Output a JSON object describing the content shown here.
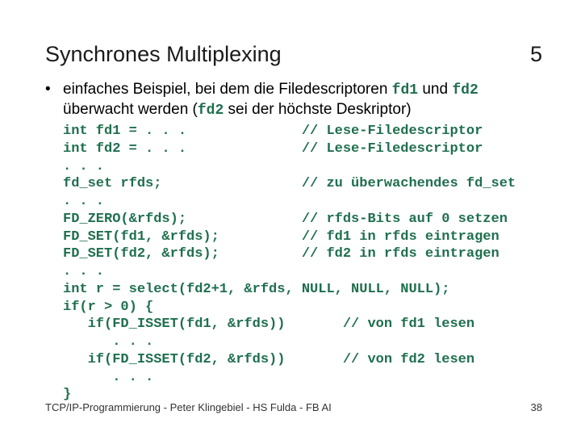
{
  "title": "Synchrones Multiplexing",
  "title_number": "5",
  "bullet": {
    "mark": "•",
    "pre": "einfaches Beispiel, bei dem die Filedescriptoren ",
    "fd1": "fd1",
    "mid": " und ",
    "fd2": "fd2",
    "after": " überwacht werden (",
    "fd2b": "fd2",
    "tail": " sei der höchste Deskriptor)"
  },
  "code": "int fd1 = . . .              // Lese-Filedescriptor\nint fd2 = . . .              // Lese-Filedescriptor\n. . .\nfd_set rfds;                 // zu überwachendes fd_set\n. . .\nFD_ZERO(&rfds);              // rfds-Bits auf 0 setzen\nFD_SET(fd1, &rfds);          // fd1 in rfds eintragen\nFD_SET(fd2, &rfds);          // fd2 in rfds eintragen\n. . .\nint r = select(fd2+1, &rfds, NULL, NULL, NULL);\nif(r > 0) {\n   if(FD_ISSET(fd1, &rfds))       // von fd1 lesen\n      . . .\n   if(FD_ISSET(fd2, &rfds))       // von fd2 lesen\n      . . .\n}",
  "footer_text": "TCP/IP-Programmierung - Peter Klingebiel - HS Fulda - FB AI",
  "page_number": "38"
}
